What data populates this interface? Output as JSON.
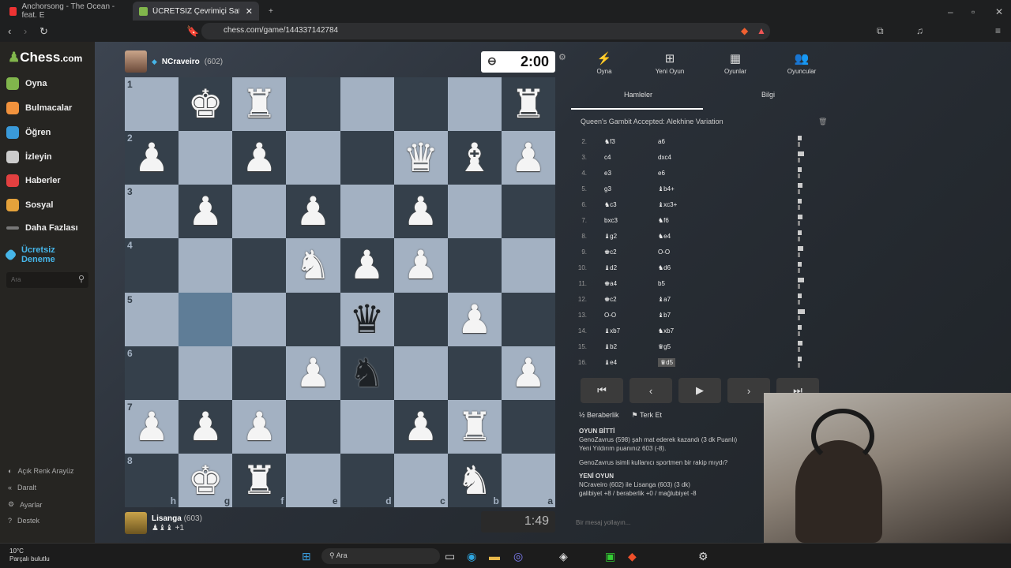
{
  "browser": {
    "tabs": [
      {
        "title": "Anchorsong - The Ocean - feat. E",
        "active": false
      },
      {
        "title": "ÜCRETSİZ Çevrimiçi Satranç Oyn",
        "active": true
      }
    ],
    "new_tab": "+",
    "url": "chess.com/game/144337142784"
  },
  "sidebar": {
    "logo_text": "Chess",
    "logo_suffix": ".com",
    "items": [
      {
        "label": "Oyna",
        "color": "#81b64c"
      },
      {
        "label": "Bulmacalar",
        "color": "#f1923d"
      },
      {
        "label": "Öğren",
        "color": "#3a9ad9"
      },
      {
        "label": "İzleyin",
        "color": "#cccccc"
      },
      {
        "label": "Haberler",
        "color": "#e24040"
      },
      {
        "label": "Sosyal",
        "color": "#e5a23b"
      },
      {
        "label": "Daha Fazlası",
        "color": "#aaaaaa"
      },
      {
        "label": "Ücretsiz Deneme",
        "color": "#46b5e8"
      }
    ],
    "search_placeholder": "Ara",
    "bottom": [
      "Açık Renk Arayüz",
      "Daralt",
      "Ayarlar",
      "Destek"
    ]
  },
  "top_player": {
    "name": "NCraveiro",
    "rating": "(602)"
  },
  "bottom_player": {
    "name": "Lisanga",
    "rating": "(603)",
    "captured": "♟♝♝ +1"
  },
  "clocks": {
    "top": "2:00",
    "bottom": "1:49"
  },
  "board": {
    "ranks": [
      "1",
      "2",
      "3",
      "4",
      "5",
      "6",
      "7",
      "8"
    ],
    "files": [
      "h",
      "g",
      "f",
      "e",
      "d",
      "c",
      "b",
      "a"
    ],
    "rows": [
      [
        "",
        "wK",
        "wR",
        "",
        "",
        "",
        "",
        "wR"
      ],
      [
        "wP",
        "",
        "wP",
        "",
        "",
        "wQ",
        "wB",
        "wP"
      ],
      [
        "",
        "wP",
        "",
        "wP",
        "",
        "wP",
        "",
        ""
      ],
      [
        "",
        "",
        "",
        "wN",
        "wP",
        "wP",
        "",
        ""
      ],
      [
        "",
        "",
        "",
        "",
        "bQ",
        "",
        "wP",
        ""
      ],
      [
        "",
        "",
        "",
        "wP",
        "bN",
        "",
        "",
        "wP"
      ],
      [
        "wP",
        "wP",
        "wP",
        "",
        "",
        "wP",
        "wR",
        ""
      ],
      [
        "",
        "wK",
        "wR",
        "",
        "",
        "",
        "wN",
        ""
      ]
    ]
  },
  "panel": {
    "tabs": [
      "Oyna",
      "Yeni Oyun",
      "Oyunlar",
      "Oyuncular"
    ],
    "subtabs": [
      "Hamleler",
      "Bilgi"
    ],
    "opening": "Queen's Gambit Accepted: Alekhine Variation",
    "moves": [
      {
        "n": "2.",
        "w": "♞f3",
        "b": "a6"
      },
      {
        "n": "3.",
        "w": "c4",
        "b": "dxc4"
      },
      {
        "n": "4.",
        "w": "e3",
        "b": "e6"
      },
      {
        "n": "5.",
        "w": "g3",
        "b": "♝b4+"
      },
      {
        "n": "6.",
        "w": "♞c3",
        "b": "♝xc3+"
      },
      {
        "n": "7.",
        "w": "bxc3",
        "b": "♞f6"
      },
      {
        "n": "8.",
        "w": "♝g2",
        "b": "♞e4"
      },
      {
        "n": "9.",
        "w": "♚c2",
        "b": "O-O"
      },
      {
        "n": "10.",
        "w": "♝d2",
        "b": "♞d6"
      },
      {
        "n": "11.",
        "w": "♚a4",
        "b": "b5"
      },
      {
        "n": "12.",
        "w": "♚c2",
        "b": "♝a7"
      },
      {
        "n": "13.",
        "w": "O-O",
        "b": "♝b7"
      },
      {
        "n": "14.",
        "w": "♝xb7",
        "b": "♞xb7"
      },
      {
        "n": "15.",
        "w": "♝b2",
        "b": "♛g5"
      },
      {
        "n": "16.",
        "w": "♝e4",
        "b": "♛d5"
      }
    ],
    "controls": [
      "⏮",
      "‹",
      "▶",
      "›",
      "⏭"
    ],
    "actions": [
      "Beraberlik",
      "Terk Et"
    ],
    "chat": [
      {
        "text": "OYUN BİTTİ",
        "head": true
      },
      {
        "text": "GenoZavrus (598) şah mat ederek kazandı (3 dk Puanlı)"
      },
      {
        "text": "Yeni Yıldırım puanınız 603 (-8)."
      },
      {
        "text": "GenoZavrus isimli kullanıcı sportmen bir rakip mıydı?"
      },
      {
        "text": "YENİ OYUN",
        "head": true
      },
      {
        "text": "NCraveiro (602) ile Lisanga (603) (3 dk)"
      },
      {
        "text": "galibiyet +8 / beraberlik +0 / mağlubiyet -8"
      }
    ],
    "chat_placeholder": "Bir mesaj yollayın..."
  },
  "taskbar": {
    "temp": "10°C",
    "weather": "Parçalı bulutlu",
    "search": "Ara"
  }
}
